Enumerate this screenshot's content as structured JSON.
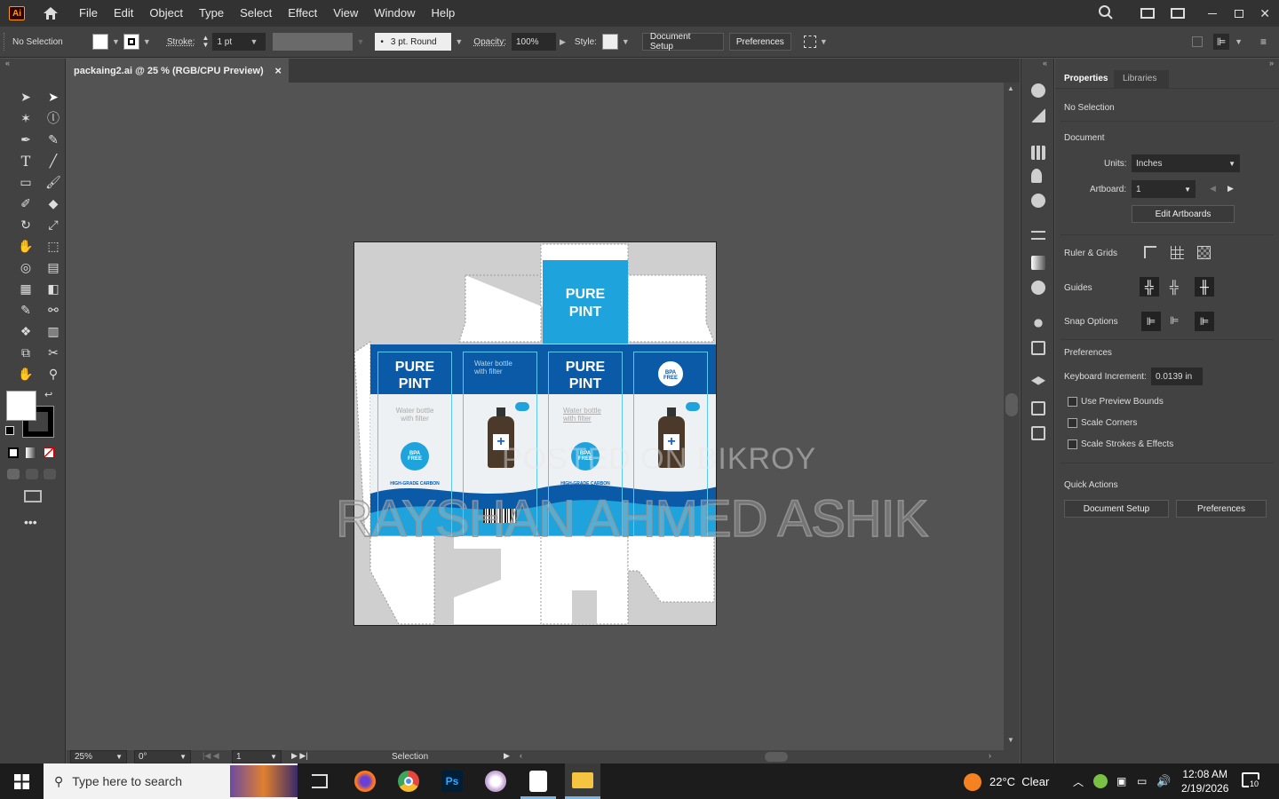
{
  "app": {
    "logo": "Ai",
    "colors": {
      "accent": "#ff9a00",
      "ui_dark": "#323232",
      "panel": "#424242",
      "canvas_bg": "#535353"
    }
  },
  "menu": [
    "File",
    "Edit",
    "Object",
    "Type",
    "Select",
    "Effect",
    "View",
    "Window",
    "Help"
  ],
  "control": {
    "selection": "No Selection",
    "stroke_label": "Stroke:",
    "stroke_value": "1 pt",
    "brush": "3 pt. Round",
    "opacity_label": "Opacity:",
    "opacity_value": "100%",
    "style_label": "Style:",
    "doc_setup": "Document Setup",
    "preferences": "Preferences"
  },
  "tab": {
    "title": "packaing2.ai @ 25 % (RGB/CPU Preview)",
    "close": "×"
  },
  "status": {
    "zoom": "25%",
    "rotate": "0°",
    "artboard": "1",
    "tool": "Selection"
  },
  "panel": {
    "tabs": [
      "Properties",
      "Libraries"
    ],
    "no_selection": "No Selection",
    "document": "Document",
    "units_label": "Units:",
    "units_value": "Inches",
    "artboard_label": "Artboard:",
    "artboard_value": "1",
    "edit_artboards": "Edit Artboards",
    "ruler": "Ruler & Grids",
    "guides": "Guides",
    "snap": "Snap Options",
    "preferences": "Preferences",
    "keyboard_label": "Keyboard Increment:",
    "keyboard_value": "0.0139 in",
    "checkbox1": "Use Preview Bounds",
    "checkbox2": "Scale Corners",
    "checkbox3": "Scale Strokes & Effects",
    "quick_actions": "Quick Actions",
    "qa_doc_setup": "Document Setup",
    "qa_preferences": "Preferences"
  },
  "artwork": {
    "brand": "PURE",
    "brand2": "PINT",
    "tagline1": "Water bottle",
    "tagline2": "with filter",
    "bpa1": "BPA",
    "bpa2": "FREE",
    "carbon": "HIGH-GRADE CARBON",
    "blue": "#0a5aa8",
    "cyan": "#1fa3dc"
  },
  "watermark": {
    "line1": "POSTED ON BIKROY",
    "line2": "RAYSHAN AHMED ASHIK"
  },
  "taskbar": {
    "search": "Type here to search",
    "weather": "22°C  Clear",
    "time": "12:08 AM",
    "date": "2/19/2026",
    "notif": "10"
  }
}
